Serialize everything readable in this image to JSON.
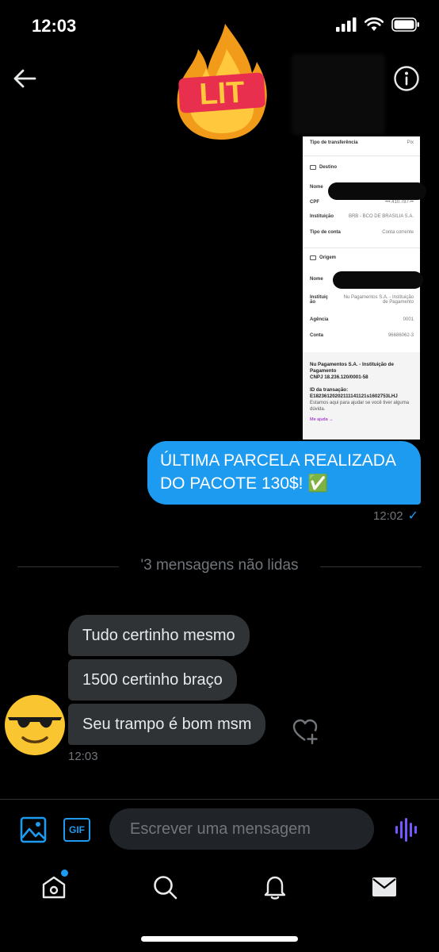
{
  "status_bar": {
    "time": "12:03"
  },
  "header": {
    "sticker_text": "LIT"
  },
  "receipt": {
    "transfer_type_label": "Tipo de transferência",
    "transfer_type_value": "Pix",
    "destination_title": "Destino",
    "name_label": "Nome",
    "cpf_label": "CPF",
    "cpf_value": "•••.410.787-••",
    "institution_label": "Instituição",
    "dest_institution_value": "BRB - BCO DE BRASILIA S.A.",
    "account_type_label": "Tipo de conta",
    "account_type_value": "Conta corrente",
    "origin_title": "Origem",
    "origin_name_label": "Nome",
    "origin_institution_label": "Instituiç ão",
    "origin_institution_value": "Nu Pagamentos S.A. - Instituição de Pagamento",
    "agency_label": "Agência",
    "agency_value": "0001",
    "account_label": "Conta",
    "account_value": "96686062-3",
    "footer_company": "Nu Pagamentos S.A. - Instituição de Pagamento",
    "footer_cnpj": "CNPJ 18.236.120/0001-58",
    "transaction_id_label": "ID da transação:",
    "transaction_id": "E18236120202111141121s1602753LHJ",
    "help_text": "Estamos aqui para ajudar se você tiver alguma dúvida.",
    "help_link": "Me ajuda →"
  },
  "outgoing": {
    "text": "ÚLTIMA PARCELA REALIZADA DO PACOTE 130$! ✅",
    "time": "12:02",
    "read_mark": "✓"
  },
  "unread_divider": "'3 mensagens não lidas",
  "incoming": {
    "messages": [
      "Tudo certinho mesmo",
      "1500 certinho braço",
      "Seu trampo é bom msm"
    ],
    "time": "12:03"
  },
  "composer": {
    "placeholder": "Escrever uma mensagem",
    "gif_label": "GIF"
  },
  "colors": {
    "accent": "#1d9bf0",
    "bubble_in": "#2f3336",
    "background": "#000000",
    "voice": "#7856ff"
  }
}
